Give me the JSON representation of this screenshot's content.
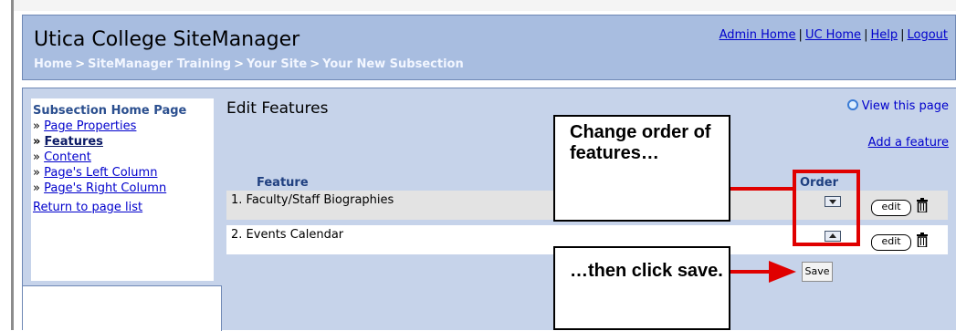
{
  "header": {
    "title": "Utica College SiteManager",
    "breadcrumb": [
      "Home",
      "SiteManager Training",
      "Your Site",
      "Your New Subsection"
    ],
    "breadcrumb_separator": ">",
    "links": [
      "Admin Home",
      "UC Home",
      "Help",
      "Logout"
    ],
    "link_separator": "|"
  },
  "sidebar": {
    "title": "Subsection Home Page",
    "items": [
      {
        "label": "Page Properties"
      },
      {
        "label": "Features",
        "active": true
      },
      {
        "label": "Content"
      },
      {
        "label": "Page's Left Column"
      },
      {
        "label": "Page's Right Column"
      }
    ],
    "bullet_inactive": "»",
    "bullet_active": "»",
    "return_link": "Return to page list"
  },
  "main": {
    "title": "Edit Features",
    "view_page": "View this page",
    "add_feature": "Add a feature",
    "columns": {
      "feature": "Feature",
      "order": "Order"
    },
    "rows": [
      {
        "index": "1.",
        "name": "Faculty/Staff Biographies",
        "order_icon": "arrow-down-icon",
        "edit": "edit"
      },
      {
        "index": "2.",
        "name": "Events Calendar",
        "order_icon": "arrow-up-icon",
        "edit": "edit"
      }
    ],
    "save": "Save"
  },
  "annotations": {
    "callout_1": "Change order of features…",
    "callout_2": "…then click save."
  },
  "colors": {
    "header_bg": "#a8bde0",
    "panel_bg": "#c6d3ea",
    "link": "#0000cc",
    "annotation_red": "#e00000"
  }
}
